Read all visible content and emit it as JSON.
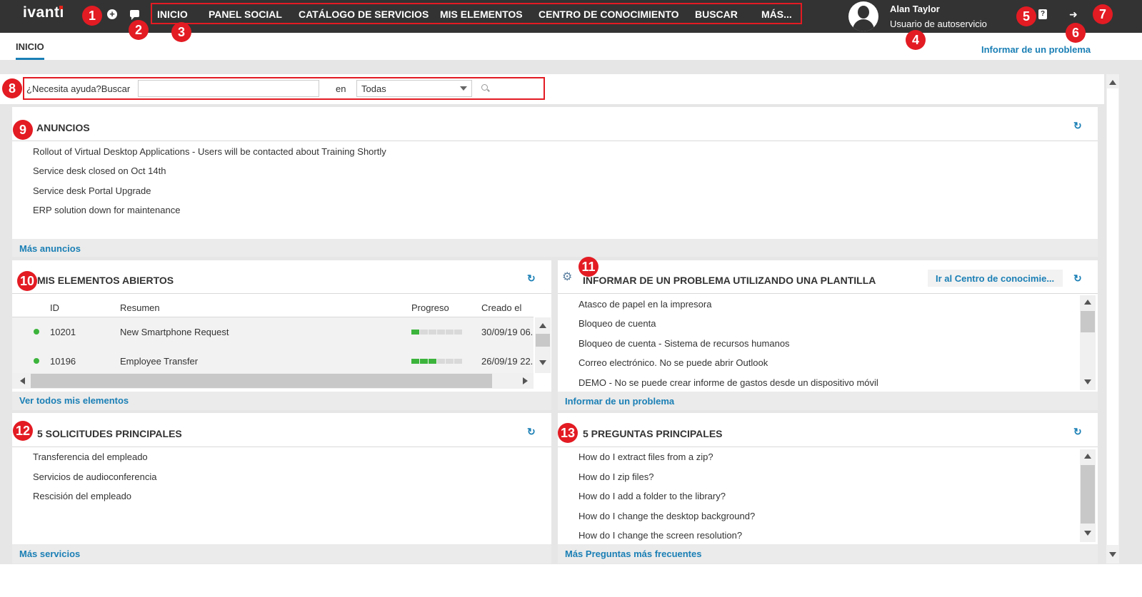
{
  "app": {
    "logo": "ivanti"
  },
  "header": {
    "nav": [
      "INICIO",
      "PANEL SOCIAL",
      "CATÁLOGO DE SERVICIOS",
      "MIS ELEMENTOS",
      "CENTRO DE CONOCIMIENTO",
      "BUSCAR",
      "MÁS..."
    ],
    "user_name": "Alan Taylor",
    "user_role": "Usuario de autoservicio",
    "help_icon": "?",
    "add_icon": "+"
  },
  "badges": [
    "1",
    "2",
    "3",
    "4",
    "5",
    "6",
    "7",
    "8",
    "9",
    "10",
    "11",
    "12",
    "13"
  ],
  "subbar": {
    "tab": "INICIO",
    "report_link": "Informar de un problema"
  },
  "search": {
    "label": "¿Necesita ayuda?Buscar",
    "input_value": "",
    "en_label": "en",
    "scope": "Todas"
  },
  "announcements": {
    "title": "ANUNCIOS",
    "items": [
      "Rollout of Virtual Desktop Applications - Users will be contacted about Training Shortly",
      "Service desk closed on Oct 14th",
      "Service desk Portal Upgrade",
      "ERP solution down for maintenance"
    ],
    "footer": "Más anuncios"
  },
  "open_items": {
    "title": "MIS ELEMENTOS ABIERTOS",
    "columns": [
      "ID",
      "Resumen",
      "Progreso",
      "Creado el"
    ],
    "rows": [
      {
        "id": "10201",
        "summary": "New Smartphone Request",
        "progress_steps": 1,
        "total_steps": 6,
        "created": "30/09/19 06."
      },
      {
        "id": "10196",
        "summary": "Employee Transfer",
        "progress_steps": 3,
        "total_steps": 6,
        "created": "26/09/19 22."
      }
    ],
    "footer": "Ver todos mis elementos"
  },
  "templates": {
    "title": "INFORMAR DE UN PROBLEMA UTILIZANDO UNA PLANTILLA",
    "kb_link": "Ir al Centro de conocimie...",
    "items": [
      "Atasco de papel en la impresora",
      "Bloqueo de cuenta",
      "Bloqueo de cuenta - Sistema de recursos humanos",
      "Correo electrónico. No se puede abrir Outlook",
      "DEMO - No se puede crear informe de gastos desde un dispositivo móvil"
    ],
    "footer": "Informar de un problema"
  },
  "top_requests": {
    "title": "5 SOLICITUDES PRINCIPALES",
    "items": [
      "Transferencia del empleado",
      "Servicios de audioconferencia",
      "Rescisión del empleado"
    ],
    "footer": "Más servicios"
  },
  "top_questions": {
    "title": "5 PREGUNTAS PRINCIPALES",
    "items": [
      "How do I extract files from a zip?",
      "How do I zip files?",
      "How do I add a folder to the library?",
      "How do I change the desktop background?",
      "How do I change the screen resolution?"
    ],
    "footer": "Más Preguntas más frecuentes"
  }
}
